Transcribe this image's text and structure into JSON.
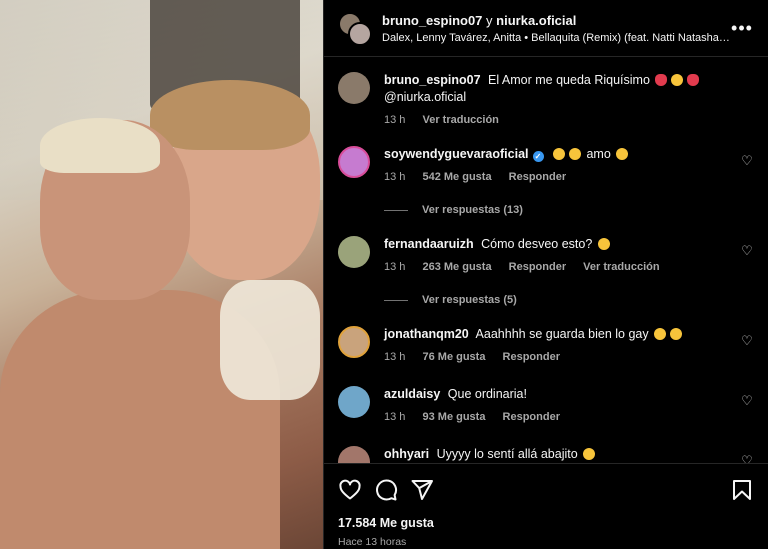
{
  "header": {
    "user1": "bruno_espino07",
    "connector": "y",
    "user2": "niurka.oficial",
    "song": "Dalex, Lenny Tavárez, Anitta • Bellaquita (Remix) (feat. Natti Natasha, ..."
  },
  "caption": {
    "user": "bruno_espino07",
    "text": "El Amor me queda Riquísimo",
    "mention": "@niurka.oficial",
    "time": "13 h",
    "translate": "Ver traducción"
  },
  "comments": [
    {
      "user": "soywendyguevaraoficial",
      "verified": true,
      "text": "amo",
      "time": "13 h",
      "likes": "542 Me gusta",
      "reply": "Responder",
      "replies": "Ver respuestas (13)"
    },
    {
      "user": "fernandaaruizh",
      "text": "Cómo desveo esto?",
      "time": "13 h",
      "likes": "263 Me gusta",
      "reply": "Responder",
      "translate": "Ver traducción",
      "replies": "Ver respuestas (5)"
    },
    {
      "user": "jonathanqm20",
      "text": "Aaahhhh se guarda bien lo gay",
      "time": "13 h",
      "likes": "76 Me gusta",
      "reply": "Responder"
    },
    {
      "user": "azuldaisy",
      "text": "Que ordinaria!",
      "time": "13 h",
      "likes": "93 Me gusta",
      "reply": "Responder"
    },
    {
      "user": "ohhyari",
      "text": "Uyyyy lo sentí allá abajito"
    }
  ],
  "footer": {
    "likes": "17.584 Me gusta",
    "time": "Hace 13 horas"
  },
  "icons": {
    "more": "more-options-icon",
    "like": "heart-icon",
    "comment": "comment-icon",
    "share": "share-icon",
    "save": "bookmark-icon"
  },
  "colors": {
    "background": "#000000",
    "text": "#f5f5f5",
    "secondary": "#a8a8a8",
    "verified": "#3897f0"
  }
}
